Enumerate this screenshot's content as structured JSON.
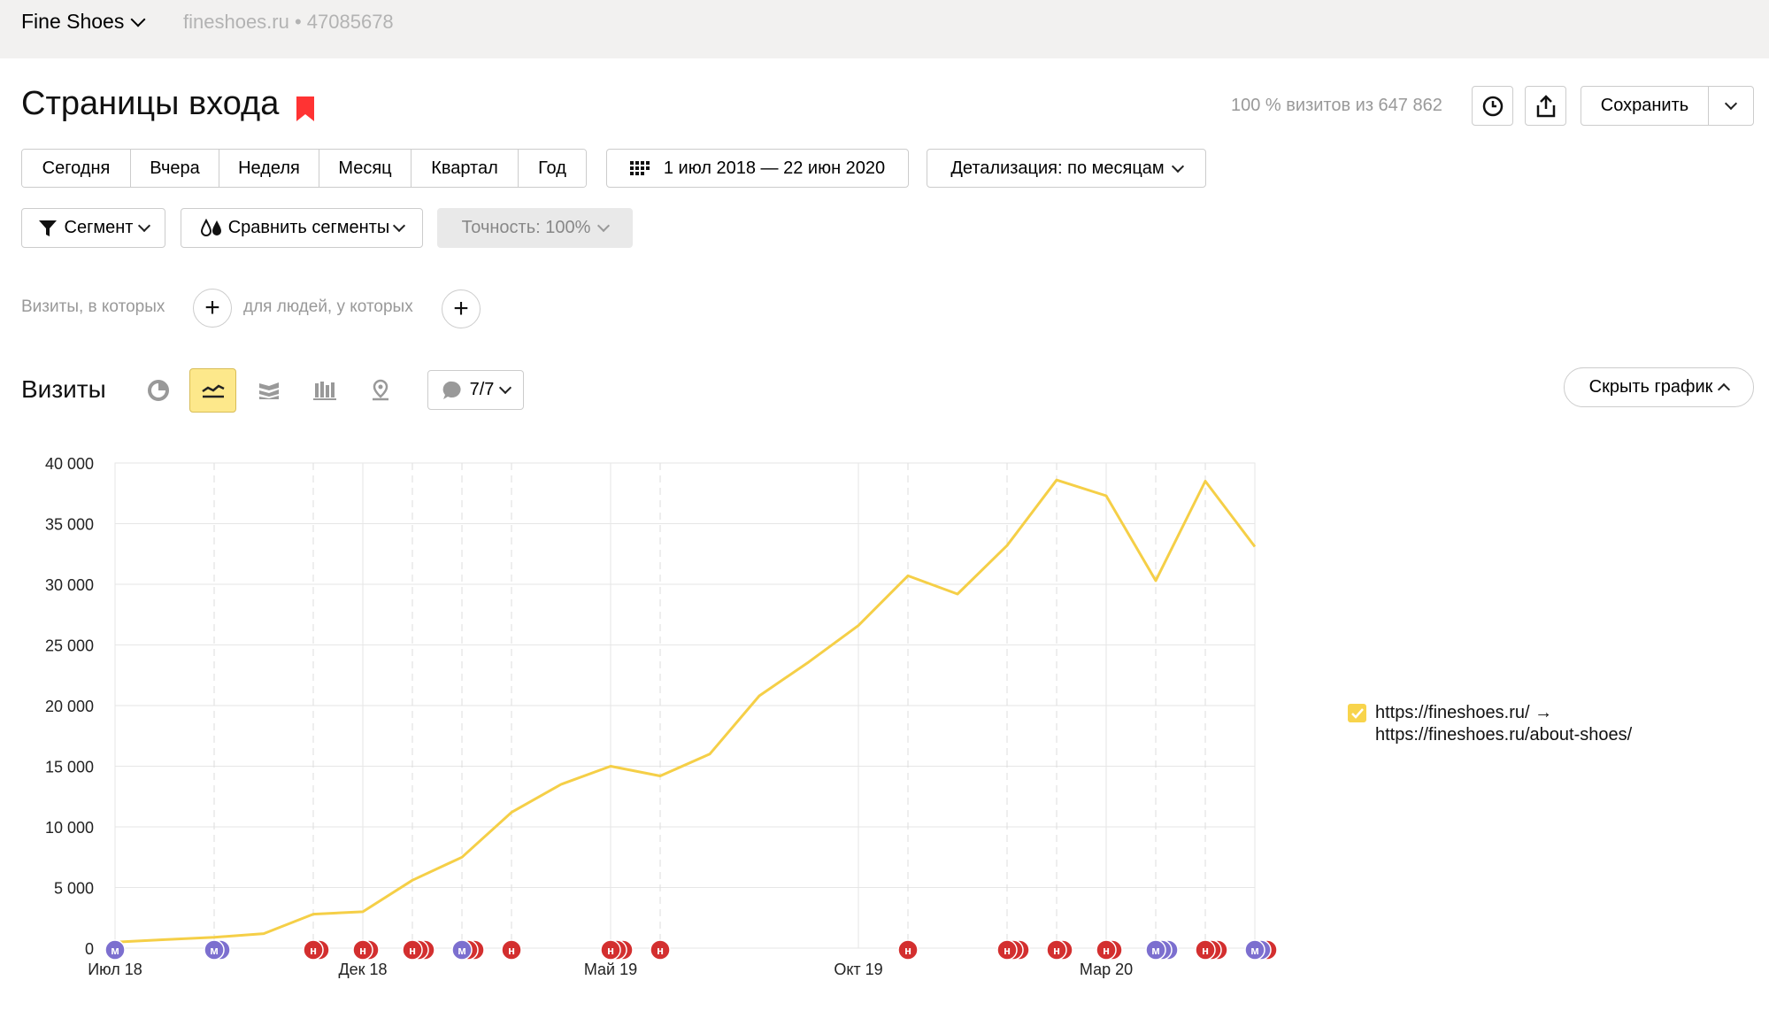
{
  "header": {
    "site_name": "Fine Shoes",
    "site_meta": "fineshoes.ru • 47085678"
  },
  "title": {
    "text": "Страницы входа",
    "visits_info": "100 % визитов из 647 862"
  },
  "toolbar": {
    "save_label": "Сохранить",
    "icons": [
      "clock-icon",
      "share-icon",
      "chevron-down-icon"
    ]
  },
  "periods": [
    "Сегодня",
    "Вчера",
    "Неделя",
    "Месяц",
    "Квартал",
    "Год"
  ],
  "date_range": "1 июл 2018 — 22 июн 2020",
  "detail": "Детализация: по месяцам",
  "segment": {
    "segment_label": "Сегмент",
    "compare_label": "Сравнить сегменты",
    "accuracy_label": "Точность: 100%"
  },
  "filters": {
    "visits_label": "Визиты, в которых",
    "people_label": "для людей, у которых"
  },
  "chart_header": {
    "title": "Визиты",
    "notes_count": "7/7",
    "hide_label": "Скрыть график"
  },
  "legend": {
    "line1": "https://fineshoes.ru/ →",
    "line2": "https://fineshoes.ru/about-shoes/"
  },
  "colors": {
    "series": "#f5cf47",
    "accent_bg": "#fde88b",
    "note_red": "#d32f2f",
    "note_purple": "#7c6fcf"
  },
  "chart_data": {
    "type": "line",
    "title": "",
    "xlabel": "",
    "ylabel": "",
    "ylim": [
      0,
      40000
    ],
    "yticks": [
      0,
      5000,
      10000,
      15000,
      20000,
      25000,
      30000,
      35000,
      40000
    ],
    "ytick_labels": [
      "0",
      "5 000",
      "10 000",
      "15 000",
      "20 000",
      "25 000",
      "30 000",
      "35 000",
      "40 000"
    ],
    "x": [
      "2018-07",
      "2018-08",
      "2018-09",
      "2018-10",
      "2018-11",
      "2018-12",
      "2019-01",
      "2019-02",
      "2019-03",
      "2019-04",
      "2019-05",
      "2019-06",
      "2019-07",
      "2019-08",
      "2019-09",
      "2019-10",
      "2019-11",
      "2019-12",
      "2020-01",
      "2020-02",
      "2020-03",
      "2020-04",
      "2020-05",
      "2020-06"
    ],
    "xtick_labels": [
      {
        "at": "2018-07",
        "label": "Июл 18"
      },
      {
        "at": "2018-12",
        "label": "Дек 18"
      },
      {
        "at": "2019-05",
        "label": "Май 19"
      },
      {
        "at": "2019-10",
        "label": "Окт 19"
      },
      {
        "at": "2020-03",
        "label": "Мар 20"
      }
    ],
    "series": [
      {
        "values": [
          500,
          700,
          900,
          1200,
          2800,
          3000,
          5600,
          7500,
          11200,
          13500,
          15000,
          14200,
          16000,
          20800,
          23600,
          26600,
          30700,
          29200,
          33200,
          38600,
          37300,
          30300,
          38500,
          33100
        ]
      }
    ],
    "grid": true,
    "legend_position": "right",
    "notes": [
      {
        "at": "2018-07",
        "types": [
          "м"
        ]
      },
      {
        "at": "2018-09",
        "types": [
          "м",
          "м"
        ]
      },
      {
        "at": "2018-11",
        "types": [
          "н",
          "н"
        ]
      },
      {
        "at": "2018-12",
        "types": [
          "н",
          "н"
        ]
      },
      {
        "at": "2019-01",
        "types": [
          "н",
          "н",
          "н"
        ]
      },
      {
        "at": "2019-02",
        "types": [
          "м",
          "н",
          "н"
        ]
      },
      {
        "at": "2019-03",
        "types": [
          "н"
        ]
      },
      {
        "at": "2019-05",
        "types": [
          "н",
          "н",
          "н"
        ]
      },
      {
        "at": "2019-06",
        "types": [
          "н"
        ]
      },
      {
        "at": "2019-11",
        "types": [
          "н"
        ]
      },
      {
        "at": "2020-01",
        "types": [
          "н",
          "н",
          "н"
        ]
      },
      {
        "at": "2020-02",
        "types": [
          "н",
          "н"
        ]
      },
      {
        "at": "2020-03",
        "types": [
          "н",
          "н"
        ]
      },
      {
        "at": "2020-04",
        "types": [
          "м",
          "м",
          "м"
        ]
      },
      {
        "at": "2020-05",
        "types": [
          "н",
          "н",
          "н"
        ]
      },
      {
        "at": "2020-06",
        "types": [
          "м",
          "м",
          "н"
        ]
      }
    ]
  }
}
